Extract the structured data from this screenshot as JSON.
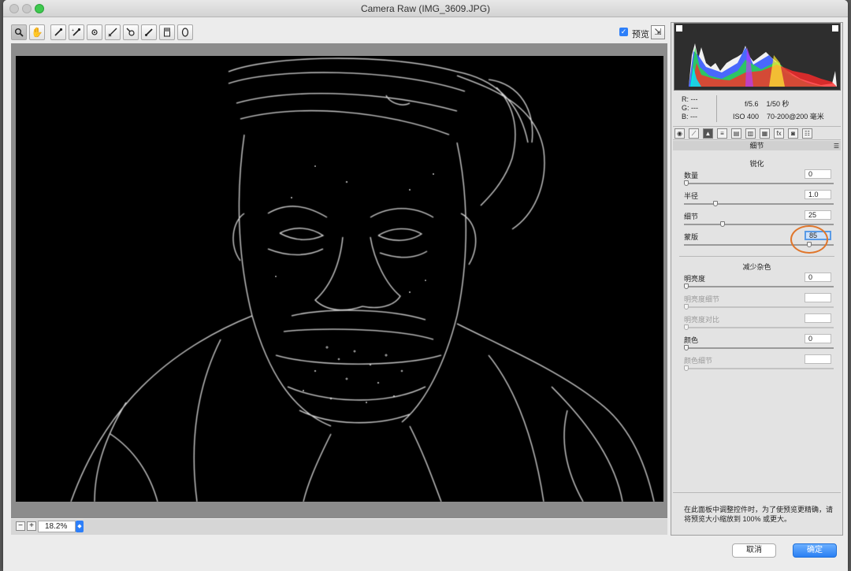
{
  "window": {
    "title": "Camera Raw (IMG_3609.JPG)"
  },
  "toolbar": {
    "tools": [
      {
        "name": "zoom-tool",
        "glyph": "🔍"
      },
      {
        "name": "hand-tool",
        "glyph": "✋"
      },
      {
        "name": "white-balance-tool",
        "glyph": "✎"
      },
      {
        "name": "color-sampler-tool",
        "glyph": "✎"
      },
      {
        "name": "targeted-adjustment-tool",
        "glyph": "⊙"
      },
      {
        "name": "straighten-tool",
        "glyph": "⟋"
      },
      {
        "name": "spot-removal-tool",
        "glyph": "✦"
      },
      {
        "name": "brush-tool",
        "glyph": "⌇"
      },
      {
        "name": "graduated-filter-tool",
        "glyph": "▯"
      },
      {
        "name": "radial-filter-tool",
        "glyph": "◯"
      }
    ],
    "preview_label": "预览",
    "preview_checked": true
  },
  "zoom": {
    "value": "18.2%",
    "minus": "−",
    "plus": "+"
  },
  "info": {
    "r_label": "R:",
    "r_value": "---",
    "g_label": "G:",
    "g_value": "---",
    "b_label": "B:",
    "b_value": "---",
    "aperture": "f/5.6",
    "shutter": "1/50 秒",
    "iso": "ISO 400",
    "lens": "70-200@200 毫米"
  },
  "panel": {
    "title": "细节",
    "menu_glyph": "☰",
    "sharpen_heading": "锐化",
    "noise_heading": "减少杂色",
    "sharpen": [
      {
        "label": "数量",
        "value": "0",
        "pos": 0
      },
      {
        "label": "半径",
        "value": "1.0",
        "pos": 0.2
      },
      {
        "label": "细节",
        "value": "25",
        "pos": 0.25
      },
      {
        "label": "蒙版",
        "value": "85",
        "pos": 0.85,
        "focused": true
      }
    ],
    "noise": [
      {
        "label": "明亮度",
        "value": "0",
        "pos": 0
      },
      {
        "label": "明亮度细节",
        "value": "",
        "pos": 0,
        "disabled": true
      },
      {
        "label": "明亮度对比",
        "value": "",
        "pos": 0,
        "disabled": true
      },
      {
        "label": "颜色",
        "value": "0",
        "pos": 0
      },
      {
        "label": "颜色细节",
        "value": "",
        "pos": 0,
        "disabled": true
      }
    ],
    "hint": "在此面板中调整控件时，为了使预览更精确，请将预览大小缩放到 100% 或更大。"
  },
  "buttons": {
    "cancel": "取消",
    "ok": "确定"
  },
  "colors": {
    "accent": "#2d7ff9",
    "highlight_ring": "#e0762b"
  }
}
